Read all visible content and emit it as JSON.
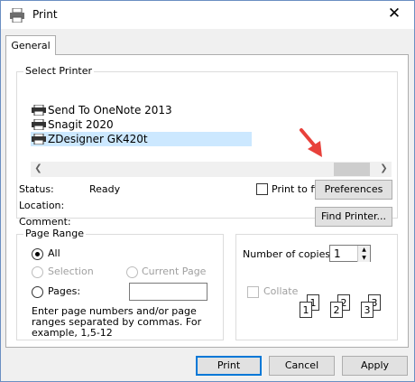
{
  "window": {
    "title": "Print",
    "close_glyph": "✕"
  },
  "tabs": [
    {
      "label": "General"
    }
  ],
  "select_printer": {
    "legend": "Select Printer",
    "printers": [
      {
        "name": "Send To OneNote 2013",
        "selected": false
      },
      {
        "name": "Snagit 2020",
        "selected": false
      },
      {
        "name": "ZDesigner GK420t",
        "selected": true
      }
    ],
    "scroll_left_glyph": "❮",
    "scroll_right_glyph": "❯",
    "status_label": "Status:",
    "status_value": "Ready",
    "location_label": "Location:",
    "comment_label": "Comment:",
    "print_to_file_label": "Print to file",
    "preferences_label": "Preferences",
    "find_printer_label": "Find Printer..."
  },
  "page_range": {
    "legend": "Page Range",
    "all_label": "All",
    "selection_label": "Selection",
    "current_page_label": "Current Page",
    "pages_label": "Pages:",
    "pages_value": "",
    "hint": "Enter page numbers and/or page ranges separated by commas.  For example, 1,5-12"
  },
  "copies": {
    "number_label": "Number of copies:",
    "number_value": "1",
    "collate_label": "Collate",
    "collate_page_numbers": [
      "1",
      "1",
      "2",
      "2",
      "3",
      "3"
    ]
  },
  "footer": {
    "print_label": "Print",
    "cancel_label": "Cancel",
    "apply_label": "Apply"
  },
  "colors": {
    "selection": "#cce8ff",
    "accent": "#0078d7",
    "annotation_arrow": "#e8413b"
  }
}
